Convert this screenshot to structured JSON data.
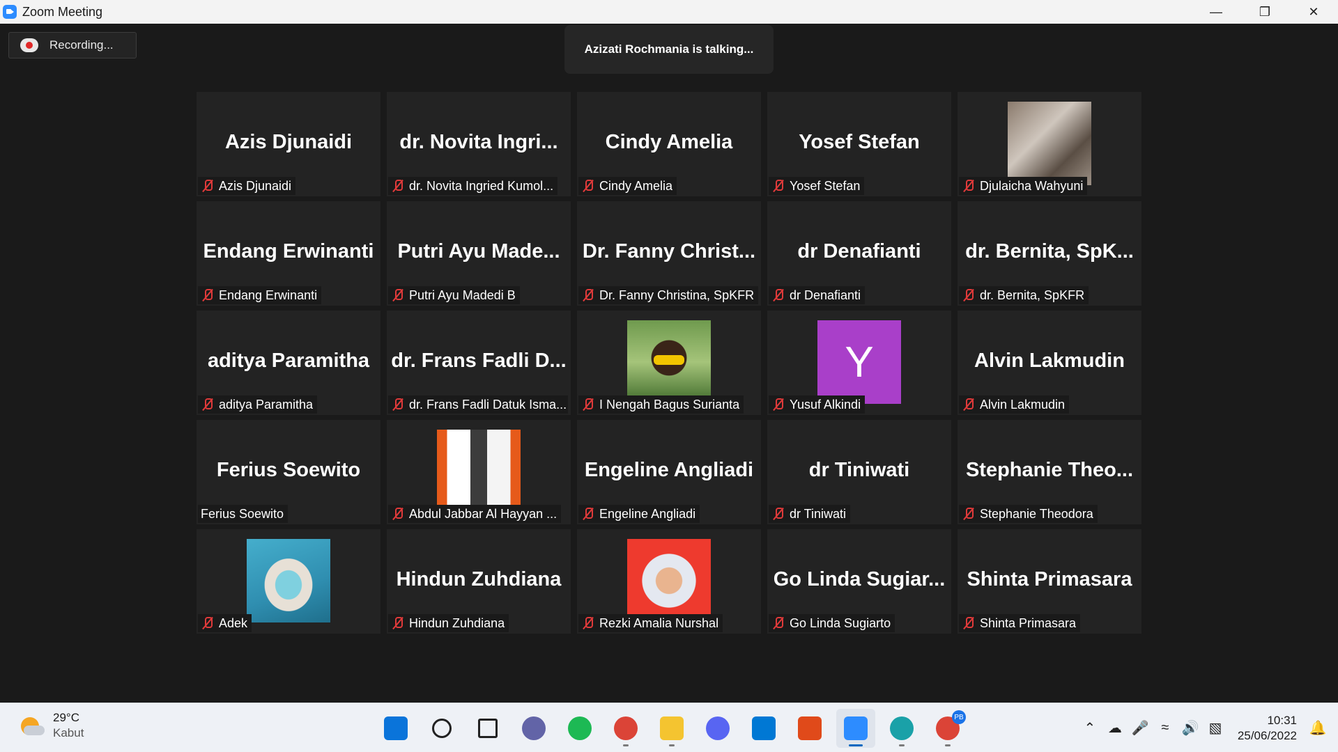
{
  "window": {
    "title": "Zoom Meeting"
  },
  "meeting": {
    "recording_label": "Recording...",
    "talking_label": "Azizati Rochmania is talking..."
  },
  "participants": [
    {
      "display": "Azis Djunaidi",
      "label": "Azis Djunaidi",
      "muted": true,
      "video": null
    },
    {
      "display": "dr. Novita Ingri...",
      "label": "dr. Novita Ingried Kumol...",
      "muted": true,
      "video": null
    },
    {
      "display": "Cindy Amelia",
      "label": "Cindy Amelia",
      "muted": true,
      "video": null
    },
    {
      "display": "Yosef Stefan",
      "label": "Yosef Stefan",
      "muted": true,
      "video": null
    },
    {
      "display": "",
      "label": "Djulaicha Wahyuni",
      "muted": true,
      "video": "sketch"
    },
    {
      "display": "Endang Erwinanti",
      "label": "Endang Erwinanti",
      "muted": true,
      "video": null
    },
    {
      "display": "Putri Ayu Made...",
      "label": "Putri Ayu Madedi B",
      "muted": true,
      "video": null
    },
    {
      "display": "Dr. Fanny Christ...",
      "label": "Dr. Fanny Christina, SpKFR",
      "muted": true,
      "video": null
    },
    {
      "display": "dr Denafianti",
      "label": "dr Denafianti",
      "muted": true,
      "video": null
    },
    {
      "display": "dr. Bernita, SpK...",
      "label": "dr. Bernita, SpKFR",
      "muted": true,
      "video": null
    },
    {
      "display": "aditya Paramitha",
      "label": "aditya Paramitha",
      "muted": true,
      "video": null
    },
    {
      "display": "dr. Frans Fadli D...",
      "label": "dr. Frans Fadli Datuk Isma...",
      "muted": true,
      "video": null
    },
    {
      "display": "",
      "label": "I Nengah Bagus Surianta",
      "muted": true,
      "video": "child"
    },
    {
      "display": "",
      "label": "Yusuf Alkindi",
      "muted": true,
      "video": "letter",
      "letter": "Y"
    },
    {
      "display": "Alvin Lakmudin",
      "label": "Alvin Lakmudin",
      "muted": true,
      "video": null
    },
    {
      "display": "Ferius Soewito",
      "label": "Ferius Soewito",
      "muted": false,
      "video": null
    },
    {
      "display": "",
      "label": "Abdul Jabbar Al Hayyan ...",
      "muted": true,
      "video": "hall"
    },
    {
      "display": "Engeline Angliadi",
      "label": "Engeline Angliadi",
      "muted": true,
      "video": null
    },
    {
      "display": "dr Tiniwati",
      "label": "dr Tiniwati",
      "muted": true,
      "video": null
    },
    {
      "display": "Stephanie Theo...",
      "label": "Stephanie Theodora",
      "muted": true,
      "video": null
    },
    {
      "display": "",
      "label": "Adek",
      "muted": true,
      "video": "mask"
    },
    {
      "display": "Hindun Zuhdiana",
      "label": "Hindun Zuhdiana",
      "muted": true,
      "video": null
    },
    {
      "display": "",
      "label": "Rezki Amalia Nurshal",
      "muted": true,
      "video": "hijab"
    },
    {
      "display": "Go Linda Sugiar...",
      "label": "Go Linda Sugiarto",
      "muted": true,
      "video": null
    },
    {
      "display": "Shinta Primasara",
      "label": "Shinta Primasara",
      "muted": true,
      "video": null
    }
  ],
  "taskbar": {
    "weather": {
      "temp": "29°C",
      "condition": "Kabut"
    },
    "apps": [
      {
        "name": "start-icon",
        "color": "#0a74da"
      },
      {
        "name": "search-icon",
        "color": "#222222"
      },
      {
        "name": "task-view-icon",
        "color": "#222222"
      },
      {
        "name": "teams-chat-icon",
        "color": "#6264a7"
      },
      {
        "name": "spotify-icon",
        "color": "#1db954"
      },
      {
        "name": "chrome-icon",
        "color": "#db4437"
      },
      {
        "name": "file-explorer-icon",
        "color": "#f4c430"
      },
      {
        "name": "discord-icon",
        "color": "#5865f2"
      },
      {
        "name": "mail-icon",
        "color": "#0078d4"
      },
      {
        "name": "store-icon",
        "color": "#e04a1a"
      },
      {
        "name": "zoom-icon",
        "color": "#2d8cff"
      },
      {
        "name": "edge-icon",
        "color": "#1aa1a8"
      },
      {
        "name": "chrome-profile-icon",
        "color": "#db4437",
        "badge": "PB"
      }
    ],
    "clock": {
      "time": "10:31",
      "date": "25/06/2022"
    }
  }
}
